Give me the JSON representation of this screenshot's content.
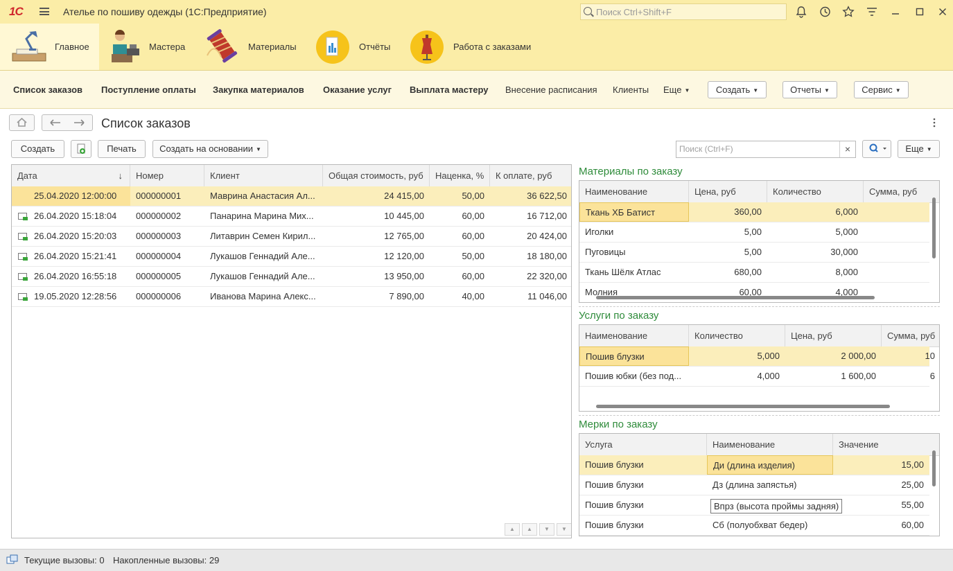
{
  "app": {
    "logo": "1С",
    "title": "Ателье по пошиву одежды  (1С:Предприятие)",
    "search_placeholder": "Поиск Ctrl+Shift+F"
  },
  "sections": [
    {
      "label": "Главное",
      "icon": "desk-lamp-icon",
      "active": true
    },
    {
      "label": "Мастера",
      "icon": "tailor-icon"
    },
    {
      "label": "Материалы",
      "icon": "thread-spool-icon"
    },
    {
      "label": "Отчёты",
      "icon": "report-icon"
    },
    {
      "label": "Работа с заказами",
      "icon": "mannequin-icon"
    }
  ],
  "funcbar": {
    "links": [
      "Список заказов",
      "Поступление оплаты",
      "Закупка материалов",
      "Оказание услуг",
      "Выплата мастеру",
      "Внесение расписания",
      "Клиенты",
      "Еще"
    ],
    "buttons": [
      "Создать",
      "Отчеты",
      "Сервис"
    ]
  },
  "form": {
    "title": "Список заказов",
    "create": "Создать",
    "print": "Печать",
    "create_based": "Создать на основании",
    "search_placeholder": "Поиск (Ctrl+F)",
    "more": "Еще",
    "clear": "×"
  },
  "orders": {
    "headers": [
      "Дата",
      "Номер",
      "Клиент",
      "Общая стоимость, руб",
      "Наценка, %",
      "К оплате, руб"
    ],
    "rows": [
      [
        "25.04.2020 12:00:00",
        "000000001",
        "Маврина Анастасия Ал...",
        "24 415,00",
        "50,00",
        "36 622,50"
      ],
      [
        "26.04.2020 15:18:04",
        "000000002",
        "Панарина  Марина Мих...",
        "10 445,00",
        "60,00",
        "16 712,00"
      ],
      [
        "26.04.2020 15:20:03",
        "000000003",
        "Литаврин Семен Кирил...",
        "12 765,00",
        "60,00",
        "20 424,00"
      ],
      [
        "26.04.2020 15:21:41",
        "000000004",
        "Лукашов Геннадий Але...",
        "12 120,00",
        "50,00",
        "18 180,00"
      ],
      [
        "26.04.2020 16:55:18",
        "000000005",
        "Лукашов Геннадий Але...",
        "13 950,00",
        "60,00",
        "22 320,00"
      ],
      [
        "19.05.2020 12:28:56",
        "000000006",
        "Иванова Марина Алекс...",
        "7 890,00",
        "40,00",
        "11 046,00"
      ]
    ]
  },
  "materials": {
    "title": "Материалы по заказу",
    "headers": [
      "Наименование",
      "Цена, руб",
      "Количество",
      "Сумма, руб"
    ],
    "rows": [
      [
        "Ткань ХБ Батист",
        "360,00",
        "6,000",
        ""
      ],
      [
        "Иголки",
        "5,00",
        "5,000",
        ""
      ],
      [
        "Пуговицы",
        "5,00",
        "30,000",
        ""
      ],
      [
        "Ткань Шёлк Атлас",
        "680,00",
        "8,000",
        ""
      ],
      [
        "Молния",
        "60,00",
        "4,000",
        ""
      ]
    ]
  },
  "services": {
    "title": "Услуги по заказу",
    "headers": [
      "Наименование",
      "Количество",
      "Цена, руб",
      "Сумма, руб"
    ],
    "rows": [
      [
        "Пошив блузки",
        "5,000",
        "2 000,00",
        "10"
      ],
      [
        "Пошив юбки (без под...",
        "4,000",
        "1 600,00",
        "6"
      ]
    ]
  },
  "measures": {
    "title": "Мерки по заказу",
    "headers": [
      "Услуга",
      "Наименование",
      "Значение"
    ],
    "rows": [
      [
        "Пошив блузки",
        "Ди (длина изделия)",
        "15,00"
      ],
      [
        "Пошив блузки",
        "Дз (длина запястья)",
        "25,00"
      ],
      [
        "Пошив блузки",
        "Впрз (высота проймы задняя)",
        "55,00"
      ],
      [
        "Пошив блузки",
        "Сб (полуобхват бедер)",
        "60,00"
      ]
    ]
  },
  "status": {
    "current_calls": "Текущие вызовы: 0",
    "accumulated_calls": "Накопленные вызовы: 29"
  },
  "colors": {
    "accent_yellow": "#fbeda7",
    "selected_row": "#fbeebb",
    "section_title_green": "#2e8b3a"
  }
}
